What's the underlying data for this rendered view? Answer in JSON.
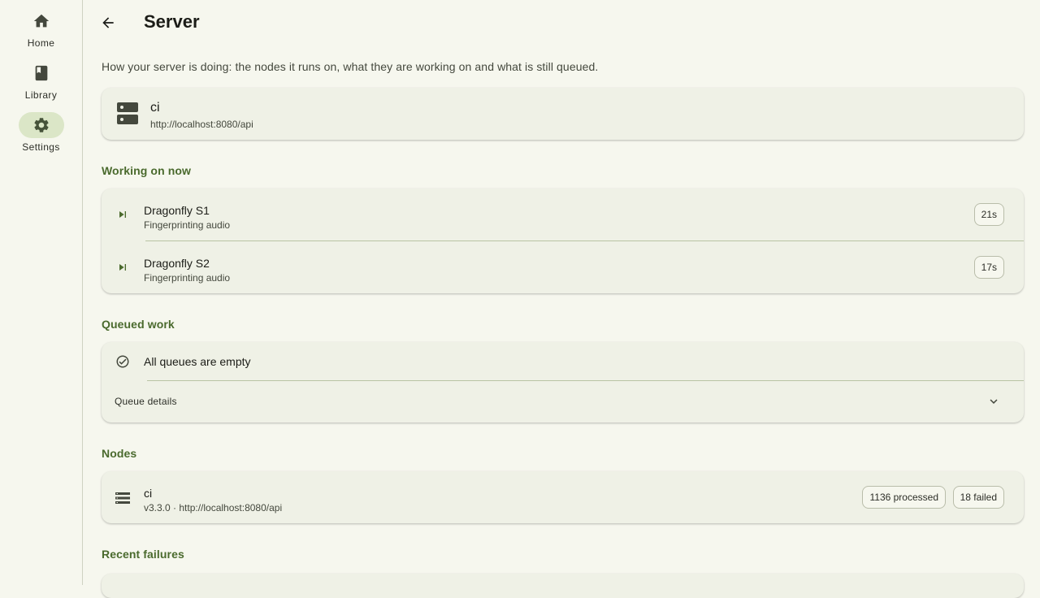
{
  "nav": {
    "items": [
      {
        "label": "Home",
        "icon": "home-icon"
      },
      {
        "label": "Library",
        "icon": "book-icon"
      },
      {
        "label": "Settings",
        "icon": "gear-icon",
        "active": true
      }
    ]
  },
  "header": {
    "title": "Server"
  },
  "intro": "How your server is doing: the nodes it runs on, what they are working on and what is still queued.",
  "server": {
    "name": "ci",
    "url": "http://localhost:8080/api"
  },
  "working": {
    "title": "Working on now",
    "jobs": [
      {
        "title": "Dragonfly S1",
        "status": "Fingerprinting audio",
        "elapsed": "21s"
      },
      {
        "title": "Dragonfly S2",
        "status": "Fingerprinting audio",
        "elapsed": "17s"
      }
    ]
  },
  "queued": {
    "title": "Queued work",
    "empty_text": "All queues are empty",
    "details_label": "Queue details"
  },
  "nodes": {
    "title": "Nodes",
    "items": [
      {
        "name": "ci",
        "meta": "v3.3.0 · http://localhost:8080/api",
        "processed": "1136 processed",
        "failed": "18 failed"
      }
    ]
  },
  "failures": {
    "title": "Recent failures"
  },
  "colors": {
    "accent": "#4a6a2d",
    "background": "#f6f7ee",
    "card": "#eff1e6",
    "active_pill": "#dbe6c7"
  }
}
